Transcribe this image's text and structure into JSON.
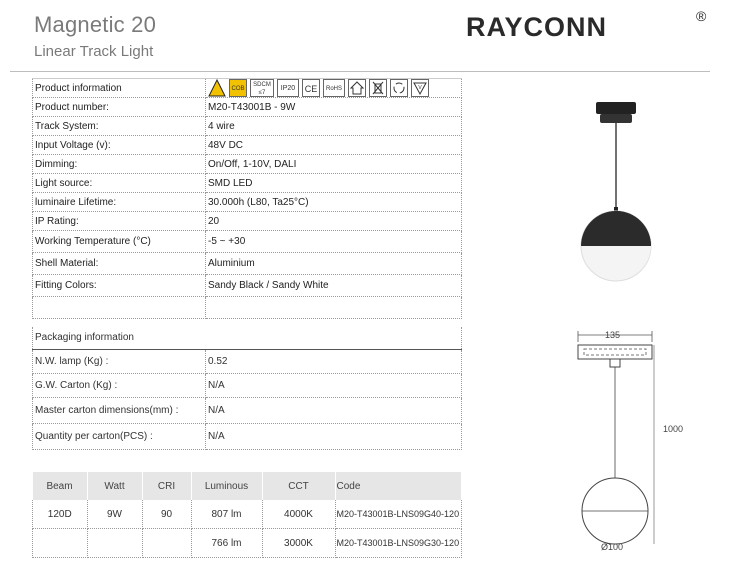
{
  "header": {
    "title": "Magnetic 20",
    "subtitle": "Linear Track Light",
    "brand": "RAYCONN",
    "brand_mark": "®"
  },
  "icons": [
    "warning-icon",
    "cob-icon",
    "sdcm-icon",
    "ip20-icon",
    "ce-icon",
    "rohs-icon",
    "house-icon",
    "weee-bin-icon",
    "recycle-icon",
    "triangle-v-icon"
  ],
  "icon_labels": {
    "cob": "COB",
    "sdcm": "SDCM ≤7",
    "ip20": "IP20",
    "ce": "CE",
    "rohs": "RoHS"
  },
  "product": {
    "section_label": "Product information",
    "rows": [
      {
        "k": "Product number:",
        "v": "M20-T43001B - 9W"
      },
      {
        "k": "Track System:",
        "v": "4 wire"
      },
      {
        "k": "Input Voltage (v):",
        "v": "48V DC"
      },
      {
        "k": "Dimming:",
        "v": "On/Off,  1-10V,  DALI"
      },
      {
        "k": "Light source:",
        "v": "SMD LED"
      },
      {
        "k": "luminaire Lifetime:",
        "v": "30.000h  (L80, Ta25°C)"
      },
      {
        "k": "IP Rating:",
        "v": "20"
      },
      {
        "k": "Working Temperature (°C)",
        "v": "-5 ~ +30"
      },
      {
        "k": "Shell Material:",
        "v": "Aluminium"
      },
      {
        "k": "Fitting Colors:",
        "v": "Sandy Black / Sandy White"
      },
      {
        "k": "",
        "v": ""
      }
    ]
  },
  "packaging": {
    "section_label": "Packaging information",
    "rows": [
      {
        "k": "N.W. lamp (Kg) :",
        "v": "0.52"
      },
      {
        "k": "G.W. Carton (Kg) :",
        "v": "N/A"
      },
      {
        "k": "Master carton dimensions(mm) :",
        "v": "N/A"
      },
      {
        "k": "Quantity per carton(PCS) :",
        "v": "N/A"
      }
    ]
  },
  "codes": {
    "headers": [
      "Beam",
      "Watt",
      "CRI",
      "Luminous",
      "CCT",
      "Code"
    ],
    "rows": [
      [
        "120D",
        "9W",
        "90",
        "807 lm",
        "4000K",
        "M20-T43001B-LNS09G40-120"
      ],
      [
        "",
        "",
        "",
        "766 lm",
        "3000K",
        "M20-T43001B-LNS09G30-120"
      ]
    ]
  },
  "drawing": {
    "width_label": "135",
    "height_label": "1000",
    "diameter_label": "Ø100"
  },
  "colors": {
    "shade": "#2b2b2b",
    "glass": "#f4f4f4",
    "warning": "#f2c200"
  }
}
